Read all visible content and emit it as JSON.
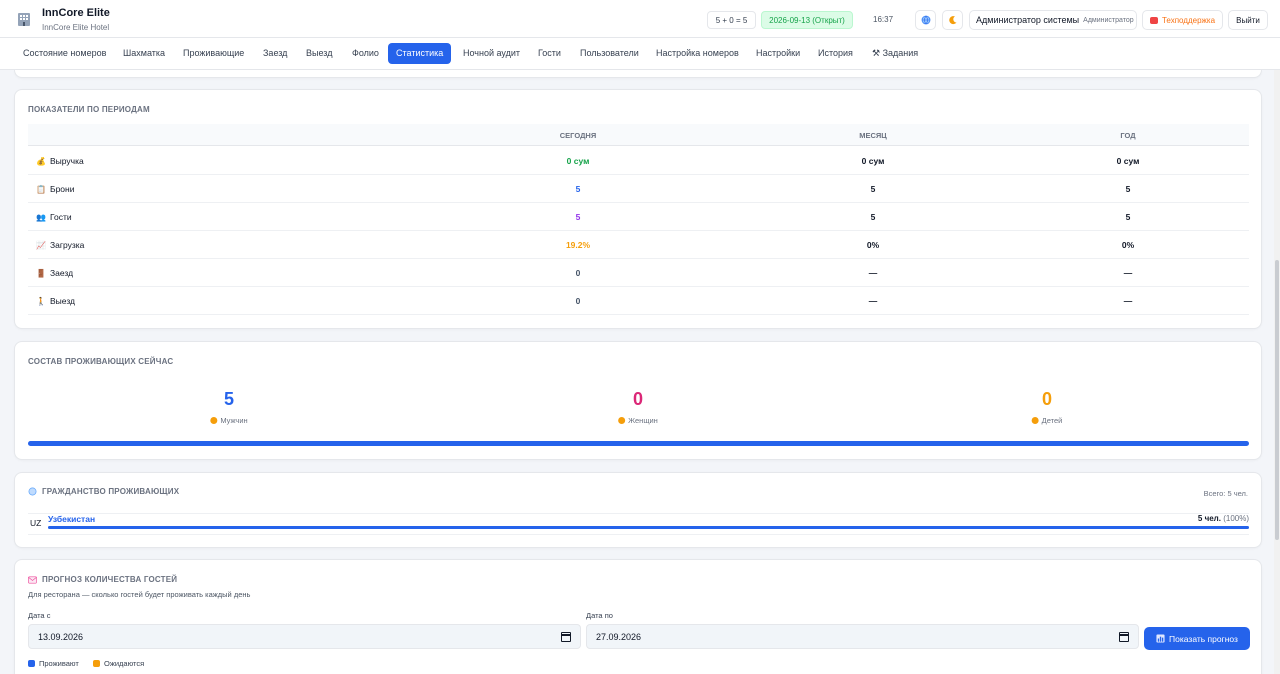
{
  "header": {
    "app_name": "InnCore Elite",
    "hotel_name": "InnCore Elite Hotel",
    "formula": "5 + 0 = 5",
    "business_date": "2026-09-13 (Открыт)",
    "time": "16:37",
    "user_name": "Администратор системы",
    "user_role": "Администратор",
    "support_label": "Техподдержка",
    "logout_label": "Выйти"
  },
  "nav": {
    "items": [
      {
        "label": "Состояние номеров"
      },
      {
        "label": "Шахматка"
      },
      {
        "label": "Проживающие"
      },
      {
        "label": "Заезд"
      },
      {
        "label": "Выезд"
      },
      {
        "label": "Фолио"
      },
      {
        "label": "Статистика",
        "active": true
      },
      {
        "label": "Ночной аудит"
      },
      {
        "label": "Гости"
      },
      {
        "label": "Пользователи"
      },
      {
        "label": "Настройка номеров"
      },
      {
        "label": "Настройки"
      },
      {
        "label": "История"
      },
      {
        "label": "⚒ Задания"
      }
    ]
  },
  "periods": {
    "title": "ПОКАЗАТЕЛИ ПО ПЕРИОДАМ",
    "columns": [
      "СЕГОДНЯ",
      "МЕСЯЦ",
      "ГОД"
    ],
    "rows": [
      {
        "icon": "💰",
        "label": "Выручка",
        "today": "0 сум",
        "month": "0 сум",
        "year": "0 сум"
      },
      {
        "icon": "📋",
        "label": "Брони",
        "today": "5",
        "month": "5",
        "year": "5"
      },
      {
        "icon": "👥",
        "label": "Гости",
        "today": "5",
        "month": "5",
        "year": "5"
      },
      {
        "icon": "📈",
        "label": "Загрузка",
        "today": "19.2%",
        "month": "0%",
        "year": "0%"
      },
      {
        "icon": "🚪",
        "label": "Заезд",
        "today": "0",
        "month": "—",
        "year": "—"
      },
      {
        "icon": "🚶",
        "label": "Выезд",
        "today": "0",
        "month": "—",
        "year": "—"
      }
    ],
    "today_colors": [
      "#16a34a",
      "#2563eb",
      "#9333ea",
      "#f59e0b",
      "#475569",
      "#475569"
    ]
  },
  "residents": {
    "title": "СОСТАВ ПРОЖИВАЮЩИХ СЕЙЧАС",
    "men": {
      "value": "5",
      "label": "Мужчин",
      "color": "#2563eb"
    },
    "women": {
      "value": "0",
      "label": "Женщин",
      "color": "#db2777"
    },
    "children": {
      "value": "0",
      "label": "Детей",
      "color": "#f59e0b"
    }
  },
  "citizenship": {
    "title": "ГРАЖДАНСТВО ПРОЖИВАЮЩИХ",
    "total": "Всего: 5 чел.",
    "rows": [
      {
        "code": "UZ",
        "country": "Узбекистан",
        "count": "5 чел.",
        "percent": "(100%)",
        "share": 1.0
      }
    ]
  },
  "forecast": {
    "title": "ПРОГНОЗ КОЛИЧЕСТВА ГОСТЕЙ",
    "subtitle": "Для ресторана — сколько гостей будет проживать каждый день",
    "date_from_label": "Дата с",
    "date_from": "13.09.2026",
    "date_to_label": "Дата по",
    "date_to": "27.09.2026",
    "button_label": "Показать прогноз",
    "legend_living": "Проживают",
    "legend_expected": "Ожидаются",
    "living_color": "#2563eb",
    "expected_color": "#f59e0b"
  }
}
